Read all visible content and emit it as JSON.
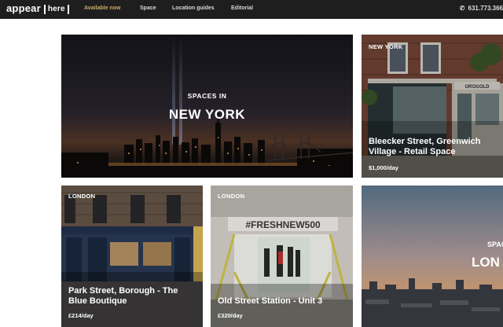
{
  "header": {
    "logo_main": "appear",
    "logo_bracket": "here",
    "nav": [
      "Available now",
      "Space",
      "Location guides",
      "Editorial"
    ],
    "phone": "631.773.366",
    "phone_icon": "phone-icon"
  },
  "hero": {
    "subtitle": "SPACES IN",
    "city": "NEW YORK"
  },
  "cards": {
    "bleecker": {
      "tag": "NEW YORK",
      "title_line1": "Bleecker Street, Greenwich",
      "title_line2": "Village - Retail Space",
      "price": "$1,000/day",
      "sign": "OROGOLD"
    },
    "park": {
      "tag": "LONDON",
      "title_line1": "Park Street, Borough - The",
      "title_line2": "Blue Boutique",
      "price": "£214/day"
    },
    "oldstreet": {
      "tag": "LONDON",
      "title": "Old Street Station - Unit 3",
      "price": "£320/day",
      "banner": "#FRESHNEW500"
    },
    "london": {
      "subtitle": "SPAC",
      "city": "LON"
    }
  }
}
